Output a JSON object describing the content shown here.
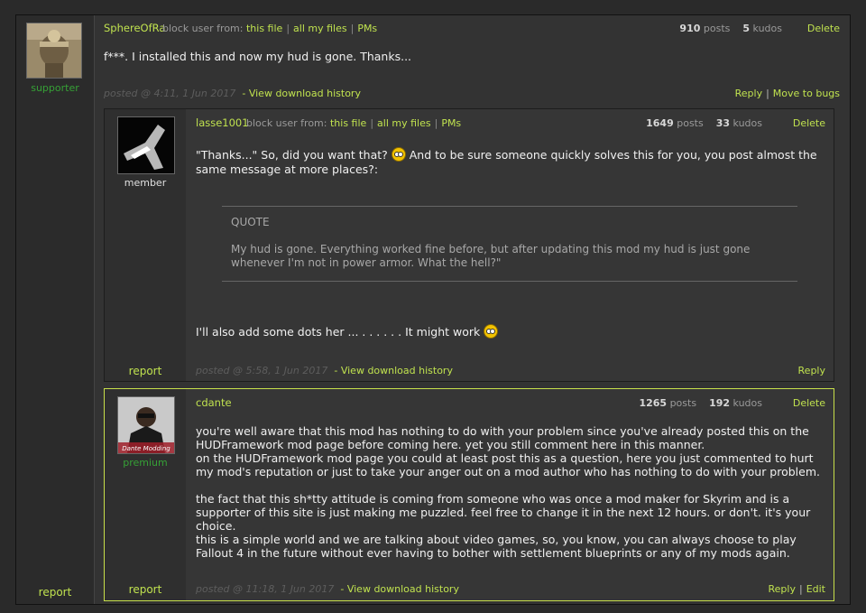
{
  "main_post": {
    "username": "SphereOfRa",
    "block_label": "block user from:",
    "block_links": [
      "this file",
      "all my files",
      "PMs"
    ],
    "posts_count": "910",
    "posts_label": "posts",
    "kudos_count": "5",
    "kudos_label": "kudos",
    "delete_label": "Delete",
    "role": "supporter",
    "report_label": "report",
    "body": "f***. I installed this and now my hud is gone. Thanks...",
    "posted": "posted @ 4:11, 1 Jun 2017",
    "history_label": "- View download history",
    "reply_label": "Reply",
    "move_label": "Move to bugs"
  },
  "reply1": {
    "username": "lasse1001",
    "block_label": "block user from:",
    "block_links": [
      "this file",
      "all my files",
      "PMs"
    ],
    "posts_count": "1649",
    "posts_label": "posts",
    "kudos_count": "33",
    "kudos_label": "kudos",
    "delete_label": "Delete",
    "role": "member",
    "report_label": "report",
    "body_line1_a": "\"Thanks...\" So, did you want that?",
    "body_line1_b": "And to be sure someone quickly solves this for you, you post almost the same message at more places?:",
    "quote_label": "QUOTE",
    "quote_text": "My hud is gone. Everything worked fine before, but after updating this mod my hud is just gone whenever I'm not in power armor. What the hell?\"",
    "body_line2": "I'll also add some dots her ... . . . . . . It might work",
    "posted": "posted @ 5:58, 1 Jun 2017",
    "history_label": "- View download history",
    "reply_label": "Reply"
  },
  "reply2": {
    "username": "cdante",
    "posts_count": "1265",
    "posts_label": "posts",
    "kudos_count": "192",
    "kudos_label": "kudos",
    "delete_label": "Delete",
    "role": "premium",
    "report_label": "report",
    "para1": "you're well aware that this mod has nothing to do with your problem since you've already posted this on the HUDFramework mod page before coming here. yet you still comment here in this manner.\non the HUDFramework mod page you could at least post this as a question, here you just commented to hurt my mod's reputation or just to take your anger out on a mod author who has nothing to do with your problem.",
    "para2": "the fact that this sh*tty attitude is coming from someone who was once a mod maker for Skyrim and is a supporter of this site is just making me puzzled. feel free to change it in the next 12 hours. or don't. it's your choice.",
    "para3": "this is a simple world and we are talking about video games, so, you know, you can always choose to play Fallout 4 in the future without ever having to bother with settlement blueprints or any of my mods again.",
    "posted": "posted @ 11:18, 1 Jun 2017",
    "history_label": "- View download history",
    "reply_label": "Reply",
    "edit_label": "Edit",
    "avatar_caption": "Dante Modding"
  },
  "colors": {
    "accent": "#c0e24f",
    "supporter": "#36a136",
    "highlight_border": "#c8e04a"
  }
}
